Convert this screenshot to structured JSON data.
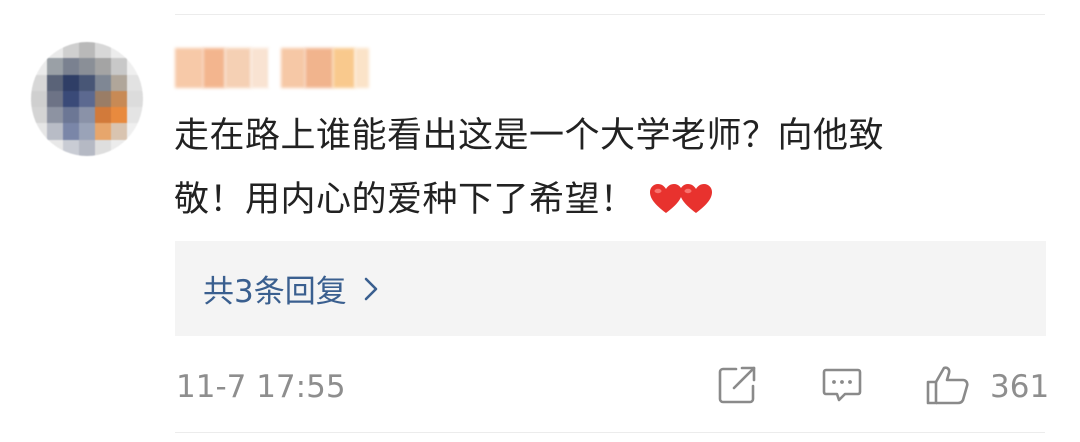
{
  "comment": {
    "text_line1": "走在路上谁能看出这是一个大学老师？向他致",
    "text_line2": "敬！用内心的爱种下了希望！",
    "emoji_icons": [
      "heart-icon",
      "heart-icon"
    ],
    "replies_label": "共3条回复",
    "timestamp": "11-7 17:55",
    "like_count": "361",
    "accent_color": "#3a5f8f",
    "heart_color": "#e8322e"
  },
  "actions": {
    "share_icon": "share-icon",
    "reply_icon": "comment-icon",
    "like_icon": "thumbs-up-icon"
  }
}
